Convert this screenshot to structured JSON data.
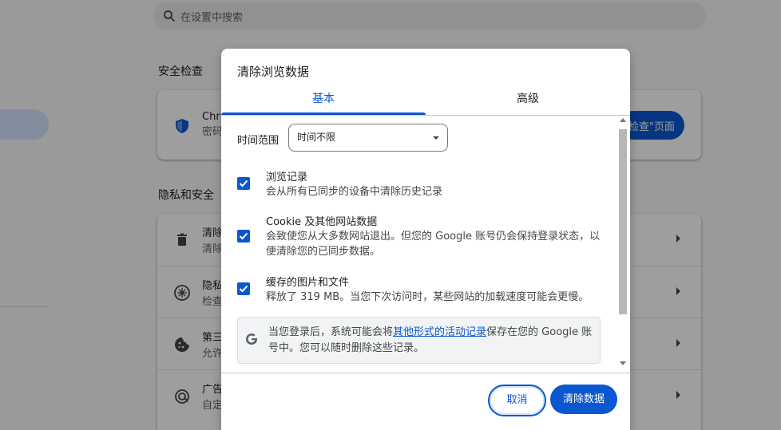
{
  "settings": {
    "search_placeholder": "在设置中搜索",
    "safety_title": "安全检查",
    "safety_card_line1": "Chr",
    "safety_card_line2": "密码",
    "safety_button": "检查\"页面",
    "privacy_title": "隐私和安全",
    "privacy_rows": [
      {
        "t1": "清除",
        "t2": "清除",
        "icon": "trash-icon"
      },
      {
        "t1": "隐私",
        "t2": "检查",
        "icon": "privacy-guide-icon"
      },
      {
        "t1": "第三",
        "t2": "允许",
        "icon": "cookie-icon"
      },
      {
        "t1": "广告",
        "t2": "自定",
        "icon": "ad-privacy-icon"
      }
    ]
  },
  "dialog": {
    "title": "清除浏览数据",
    "tabs": [
      "基本",
      "高级"
    ],
    "time_range_label": "时间范围",
    "time_range_value": "时间不限",
    "options": [
      {
        "title": "浏览记录",
        "desc": "会从所有已同步的设备中清除历史记录",
        "checked": true
      },
      {
        "title": "Cookie 及其他网站数据",
        "desc": "会致使您从大多数网站退出。但您的 Google 账号仍会保持登录状态，以便清除您的已同步数据。",
        "checked": true
      },
      {
        "title": "缓存的图片和文件",
        "desc": "释放了 319 MB。当您下次访问时，某些网站的加载速度可能会更慢。",
        "checked": true
      }
    ],
    "info_prefix": "当您登录后，系统可能会将",
    "info_link": "其他形式的活动记录",
    "info_suffix": "保存在您的 Google 账号中。您可以随时删除这些记录。",
    "cancel_label": "取消",
    "clear_label": "清除数据"
  },
  "colors": {
    "accent": "#0b57d0",
    "scrim": "rgba(0,0,0,0.38)"
  }
}
